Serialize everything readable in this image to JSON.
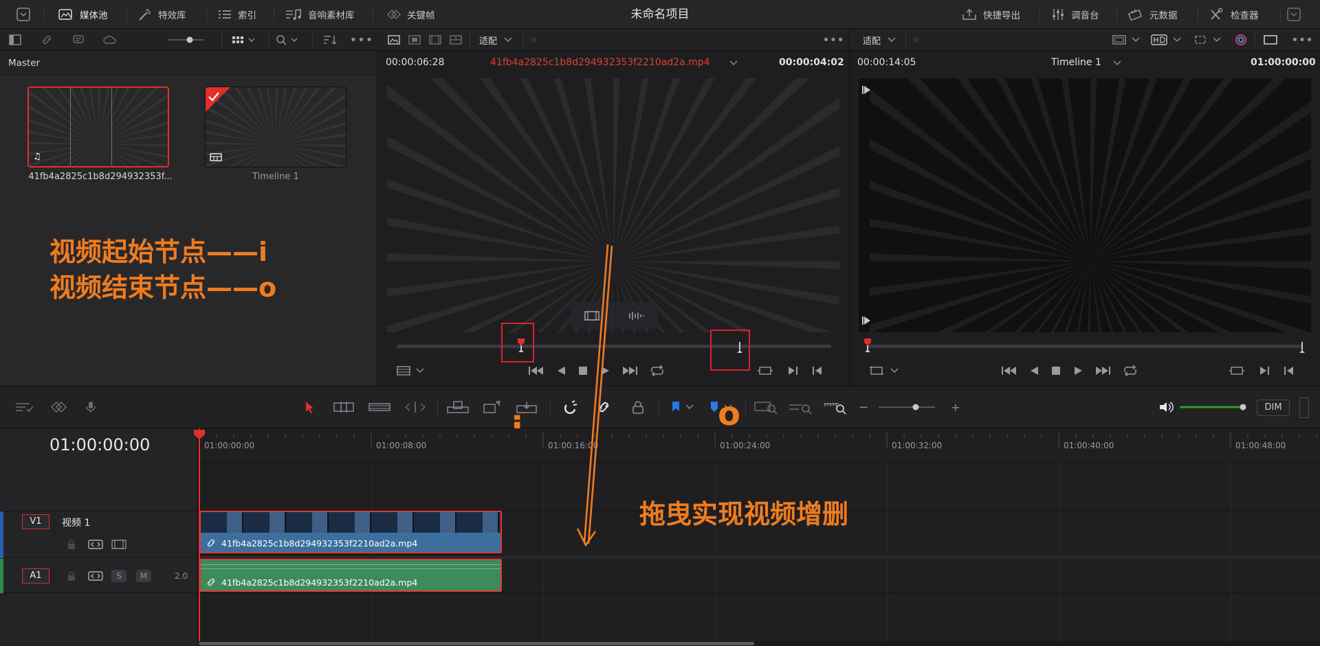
{
  "topbar": {
    "media_pool": "媒体池",
    "effects": "特效库",
    "index": "索引",
    "sound_library": "音响素材库",
    "keyframes": "关键帧",
    "project_title": "未命名项目",
    "quick_export": "快捷导出",
    "mixer": "调音台",
    "metadata": "元数据",
    "inspector": "检查器"
  },
  "mediapool": {
    "bin": "Master",
    "clips": [
      {
        "name": "41fb4a2825c1b8d294932353f..."
      },
      {
        "name": "Timeline 1"
      }
    ]
  },
  "source_viewer": {
    "zoom": "适配",
    "timecode_left": "00:00:06:28",
    "clip_name": "41fb4a2825c1b8d294932353f2210ad2a.mp4",
    "timecode_right": "00:00:04:02"
  },
  "program_viewer": {
    "zoom": "适配",
    "timecode_left": "00:00:14:05",
    "timeline_name": "Timeline 1",
    "timecode_right": "01:00:00:00"
  },
  "timeline": {
    "current_tc": "01:00:00:00",
    "ruler": [
      "01:00:00:00",
      "01:00:08:00",
      "01:00:16:00",
      "01:00:24:00",
      "01:00:32:00",
      "01:00:40:00",
      "01:00:48:00"
    ],
    "dim_label": "DIM",
    "tracks": [
      {
        "id": "V1",
        "name": "视频 1",
        "clip": "41fb4a2825c1b8d294932353f2210ad2a.mp4"
      },
      {
        "id": "A1",
        "name": "2.0",
        "clip": "41fb4a2825c1b8d294932353f2210ad2a.mp4",
        "solo": "S",
        "mute": "M"
      }
    ]
  },
  "annotations": {
    "in_point": "视频起始节点——i",
    "out_point": "视频结束节点——o",
    "drag_hint": "拖曳实现视频增删",
    "i_letter": "i",
    "o_letter": "o"
  },
  "colors": {
    "annotation": "#f07c1e",
    "highlight_box": "#e0202a",
    "audio_clip": "#3e8a5d",
    "video_clip_bar": "#3d6f9e",
    "playhead": "#e0302a"
  }
}
